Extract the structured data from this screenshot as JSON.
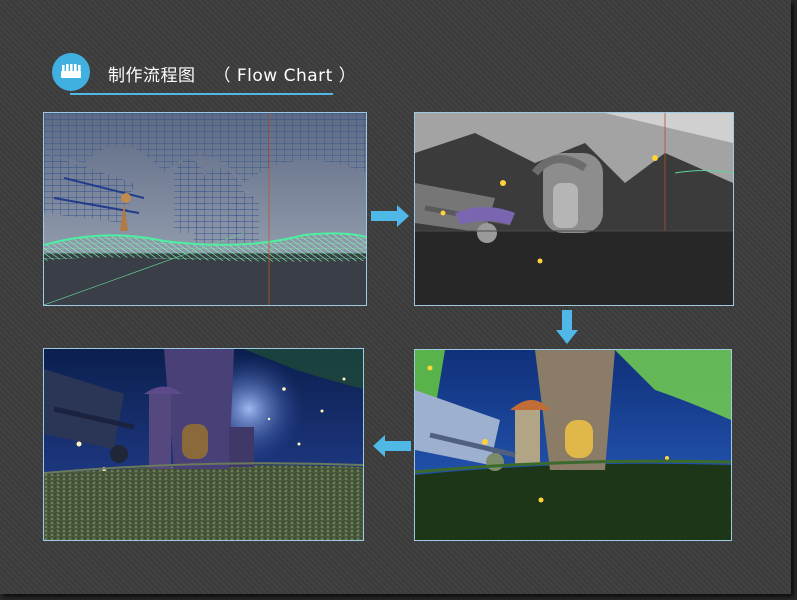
{
  "header": {
    "title_cn": "制作流程图",
    "title_en": "（ Flow Chart ）",
    "icon": "comb-icon",
    "accent_color": "#3fb0df"
  },
  "flow": {
    "steps": [
      {
        "stage": "wireframe"
      },
      {
        "stage": "gray-model"
      },
      {
        "stage": "textured"
      },
      {
        "stage": "final-render"
      }
    ],
    "arrow_color": "#4fb8e6"
  }
}
